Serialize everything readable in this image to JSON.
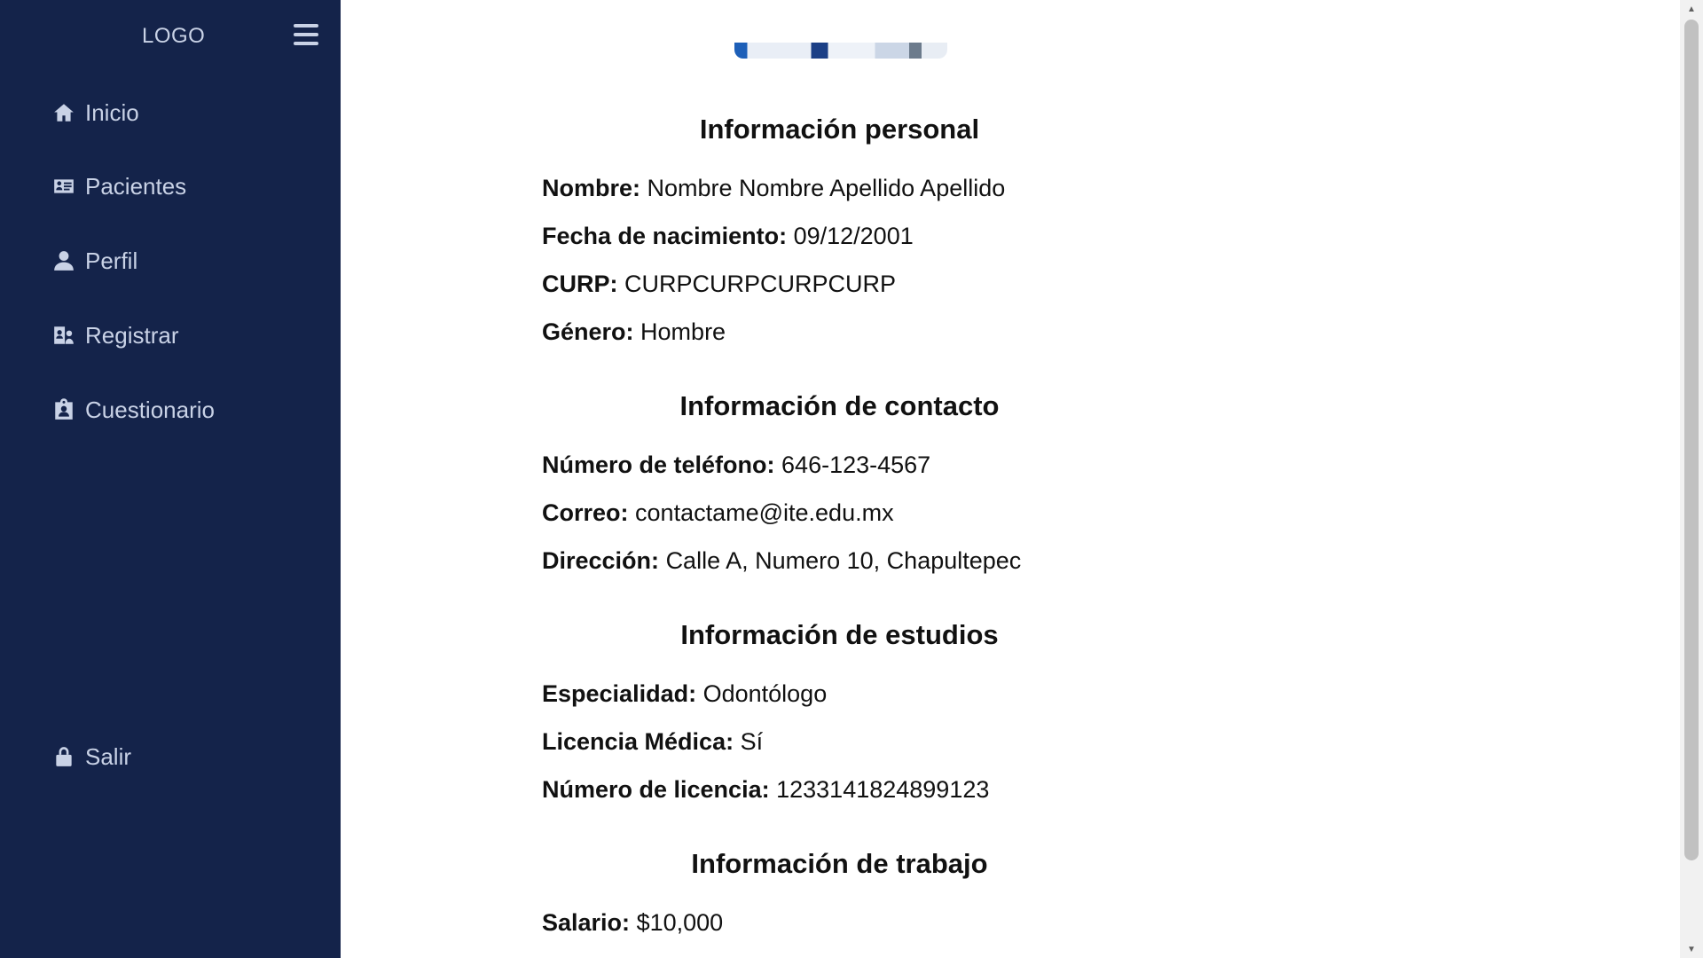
{
  "sidebar": {
    "logo": "LOGO",
    "menu_icon": "hamburger-menu-icon",
    "items": [
      {
        "label": "Inicio",
        "icon": "home-icon"
      },
      {
        "label": "Pacientes",
        "icon": "id-card-icon"
      },
      {
        "label": "Perfil",
        "icon": "user-icon"
      },
      {
        "label": "Registrar",
        "icon": "user-register-icon"
      },
      {
        "label": "Cuestionario",
        "icon": "clipboard-user-icon"
      }
    ],
    "logout": {
      "label": "Salir",
      "icon": "lock-icon"
    }
  },
  "profile": {
    "personal": {
      "title": "Información personal",
      "nombre": {
        "label": "Nombre:",
        "value": "Nombre Nombre Apellido Apellido"
      },
      "fecha": {
        "label": "Fecha de nacimiento:",
        "value": "09/12/2001"
      },
      "curp": {
        "label": "CURP:",
        "value": "CURPCURPCURPCURP"
      },
      "genero": {
        "label": "Género:",
        "value": "Hombre"
      }
    },
    "contact": {
      "title": "Información de contacto",
      "telefono": {
        "label": "Número de teléfono:",
        "value": "646-123-4567"
      },
      "correo": {
        "label": "Correo:",
        "value": "contactame@ite.edu.mx"
      },
      "direccion": {
        "label": "Dirección:",
        "value": "Calle A, Numero 10, Chapultepec"
      }
    },
    "studies": {
      "title": "Información de estudios",
      "especialidad": {
        "label": "Especialidad:",
        "value": "Odontólogo"
      },
      "licencia": {
        "label": "Licencia Médica:",
        "value": "Sí"
      },
      "numero_licencia": {
        "label": "Número de licencia:",
        "value": "1233141824899123"
      }
    },
    "work": {
      "title": "Información de trabajo",
      "salario": {
        "label": "Salario:",
        "value": "$10,000"
      }
    }
  },
  "colors": {
    "sidebar_bg": "#14234a",
    "sidebar_text": "#c9d2e6",
    "content_bg": "#ffffff",
    "text": "#111111"
  }
}
